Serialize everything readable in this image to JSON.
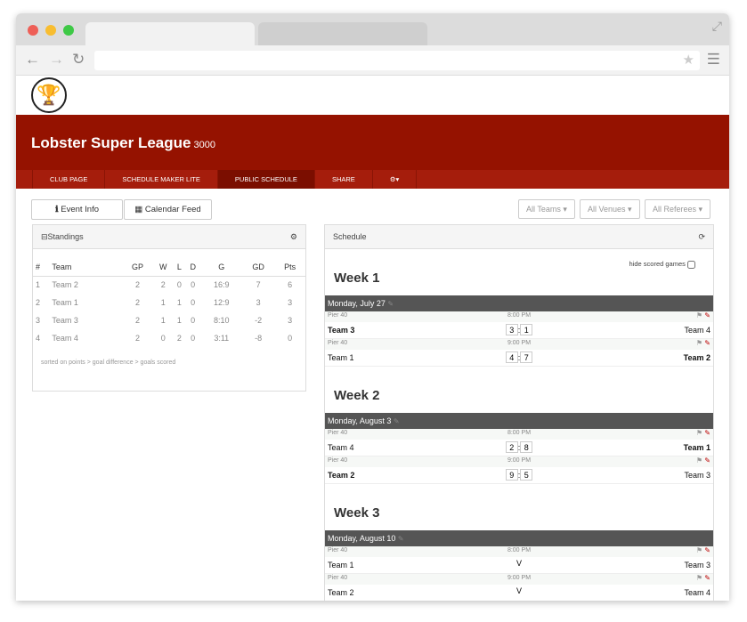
{
  "league": {
    "title": "Lobster Super League",
    "edition": "3000"
  },
  "nav": [
    {
      "label": "CLUB PAGE"
    },
    {
      "label": "SCHEDULE MAKER LITE"
    },
    {
      "label": "PUBLIC SCHEDULE",
      "active": true
    },
    {
      "label": "SHARE"
    },
    {
      "label": "⚙▾"
    }
  ],
  "buttons": {
    "event_info": "Event Info",
    "calendar_feed": "Calendar Feed"
  },
  "filters": [
    "All Teams",
    "All Venues",
    "All Referees"
  ],
  "standings": {
    "title": "Standings",
    "headers": [
      "#",
      "Team",
      "GP",
      "W",
      "L",
      "D",
      "G",
      "GD",
      "Pts"
    ],
    "rows": [
      [
        "1",
        "Team 2",
        "2",
        "2",
        "0",
        "0",
        "16:9",
        "7",
        "6"
      ],
      [
        "2",
        "Team 1",
        "2",
        "1",
        "1",
        "0",
        "12:9",
        "3",
        "3"
      ],
      [
        "3",
        "Team 3",
        "2",
        "1",
        "1",
        "0",
        "8:10",
        "-2",
        "3"
      ],
      [
        "4",
        "Team 4",
        "2",
        "0",
        "2",
        "0",
        "3:11",
        "-8",
        "0"
      ]
    ],
    "note": "sorted on points > goal difference > goals scored"
  },
  "schedule": {
    "title": "Schedule",
    "hide_label": "hide scored games",
    "weeks": [
      {
        "label": "Week 1",
        "day": "Monday, July 27",
        "games": [
          {
            "venue": "Pier 40",
            "time": "8:00 PM",
            "home": "Team 3",
            "away": "Team 4",
            "hs": "3",
            "as": "1",
            "winner": "home"
          },
          {
            "venue": "Pier 40",
            "time": "9:00 PM",
            "home": "Team 1",
            "away": "Team 2",
            "hs": "4",
            "as": "7",
            "winner": "away"
          }
        ]
      },
      {
        "label": "Week 2",
        "day": "Monday, August 3",
        "games": [
          {
            "venue": "Pier 40",
            "time": "8:00 PM",
            "home": "Team 4",
            "away": "Team 1",
            "hs": "2",
            "as": "8",
            "winner": "away"
          },
          {
            "venue": "Pier 40",
            "time": "9:00 PM",
            "home": "Team 2",
            "away": "Team 3",
            "hs": "9",
            "as": "5",
            "winner": "home"
          }
        ]
      },
      {
        "label": "Week 3",
        "day": "Monday, August 10",
        "games": [
          {
            "venue": "Pier 40",
            "time": "8:00 PM",
            "home": "Team 1",
            "away": "Team 3",
            "vs": "V"
          },
          {
            "venue": "Pier 40",
            "time": "9:00 PM",
            "home": "Team 2",
            "away": "Team 4",
            "vs": "V"
          }
        ]
      }
    ]
  },
  "colors": {
    "brand": "#951200",
    "nav": "#a51d0c",
    "nav_active": "#7b0e00"
  }
}
